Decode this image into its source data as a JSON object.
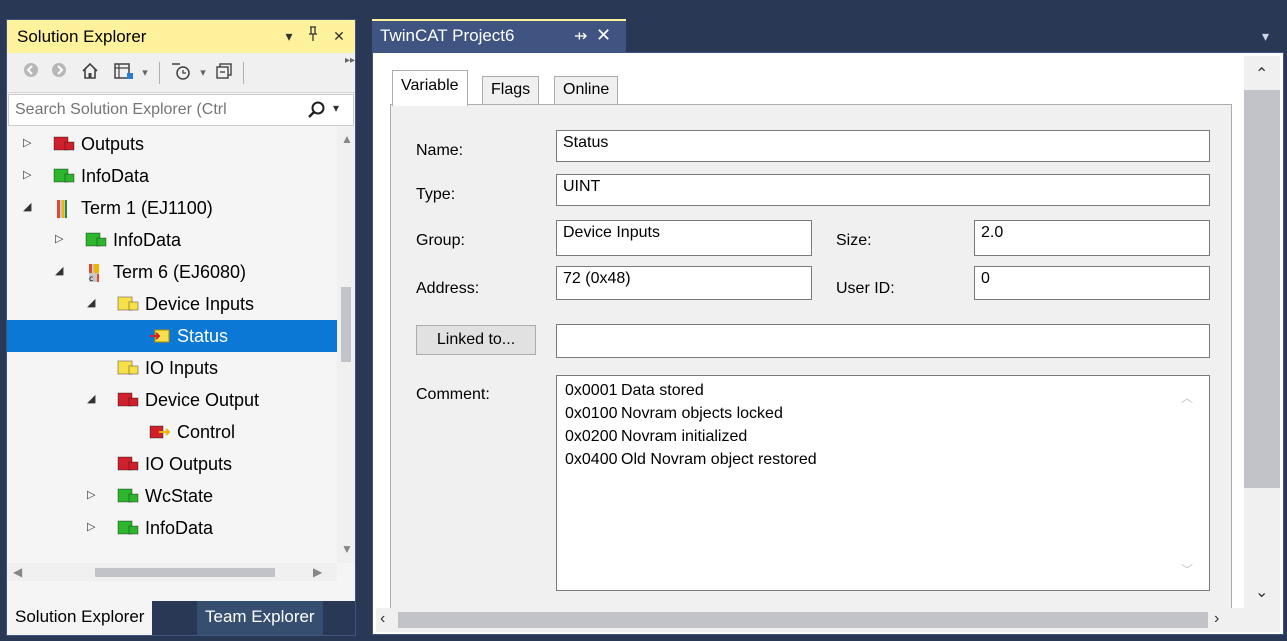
{
  "solution_explorer": {
    "title": "Solution Explorer",
    "search_placeholder": "Search Solution Explorer (Ctrl",
    "tree": [
      {
        "label": "Outputs",
        "depth": 0,
        "expander": "collapsed",
        "icon": "red-tag-icon"
      },
      {
        "label": "InfoData",
        "depth": 0,
        "expander": "collapsed",
        "icon": "green-tag-icon"
      },
      {
        "label": "Term 1 (EJ1100)",
        "depth": 0,
        "expander": "expanded",
        "icon": "terminal-ej1100-icon"
      },
      {
        "label": "InfoData",
        "depth": 1,
        "expander": "collapsed",
        "icon": "green-tag-icon"
      },
      {
        "label": "Term 6 (EJ6080)",
        "depth": 1,
        "expander": "expanded",
        "icon": "terminal-ej6080-icon"
      },
      {
        "label": "Device Inputs",
        "depth": 2,
        "expander": "expanded",
        "icon": "yellow-tag-icon"
      },
      {
        "label": "Status",
        "depth": 3,
        "expander": "none",
        "icon": "input-variable-icon",
        "selected": true
      },
      {
        "label": "IO Inputs",
        "depth": 2,
        "expander": "none",
        "icon": "yellow-tag-icon"
      },
      {
        "label": "Device Output",
        "depth": 2,
        "expander": "expanded",
        "icon": "red-tag-icon"
      },
      {
        "label": "Control",
        "depth": 3,
        "expander": "none",
        "icon": "output-variable-icon"
      },
      {
        "label": "IO Outputs",
        "depth": 2,
        "expander": "none",
        "icon": "red-tag-icon"
      },
      {
        "label": "WcState",
        "depth": 2,
        "expander": "collapsed",
        "icon": "green-tag-icon"
      },
      {
        "label": "InfoData",
        "depth": 2,
        "expander": "collapsed",
        "icon": "green-tag-icon"
      }
    ],
    "bottom_tabs": {
      "solution": "Solution Explorer",
      "team": "Team Explorer"
    }
  },
  "document": {
    "tab_title": "TwinCAT Project6",
    "property_tabs": {
      "variable": "Variable",
      "flags": "Flags",
      "online": "Online"
    },
    "labels": {
      "name": "Name:",
      "type": "Type:",
      "group": "Group:",
      "size": "Size:",
      "address": "Address:",
      "user_id": "User ID:",
      "comment": "Comment:"
    },
    "values": {
      "name": "Status",
      "type": "UINT",
      "group": "Device Inputs",
      "size": "2.0",
      "address": "72 (0x48)",
      "user_id": "0",
      "linked": ""
    },
    "linked_button": "Linked to...",
    "comment_lines": [
      {
        "code": "0x0001",
        "text": "Data stored"
      },
      {
        "code": "0x0100",
        "text": "Novram objects locked"
      },
      {
        "code": "0x0200",
        "text": "Novram initialized"
      },
      {
        "code": "0x0400",
        "text": "Old Novram object restored"
      }
    ]
  },
  "colors": {
    "frame": "#293955",
    "active_header": "#fff29d",
    "selection": "#0a78d4",
    "tag_red": "#d0202c",
    "tag_green": "#2db52d",
    "tag_yellow": "#f8e04a"
  }
}
